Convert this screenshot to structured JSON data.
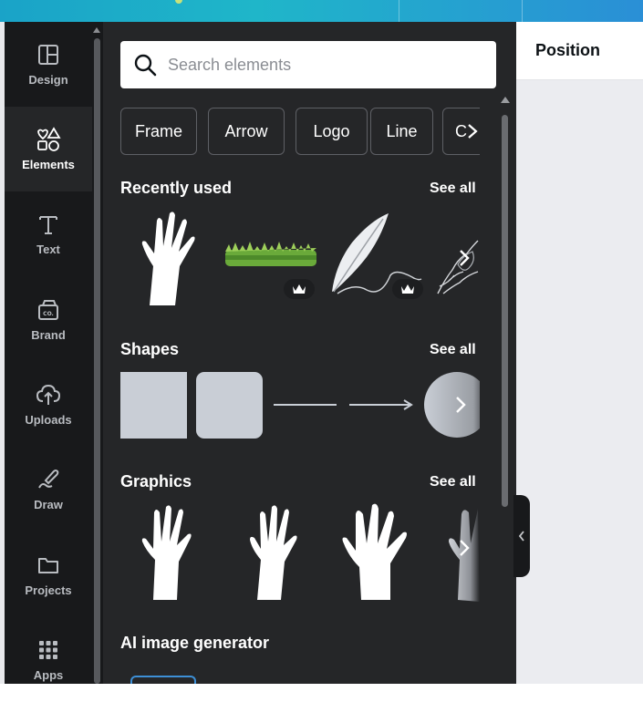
{
  "rail": {
    "items": [
      {
        "label": "Design",
        "icon": "layout-icon"
      },
      {
        "label": "Elements",
        "icon": "shapes-icon",
        "active": true
      },
      {
        "label": "Text",
        "icon": "text-icon"
      },
      {
        "label": "Brand",
        "icon": "brand-icon"
      },
      {
        "label": "Uploads",
        "icon": "cloud-upload-icon"
      },
      {
        "label": "Draw",
        "icon": "draw-icon"
      },
      {
        "label": "Projects",
        "icon": "folder-icon"
      },
      {
        "label": "Apps",
        "icon": "apps-grid-icon"
      }
    ]
  },
  "search": {
    "placeholder": "Search elements",
    "value": ""
  },
  "chips": [
    "Frame",
    "Arrow",
    "Logo",
    "Line",
    "C"
  ],
  "sections": {
    "recent": {
      "title": "Recently used",
      "see_all": "See all"
    },
    "shapes": {
      "title": "Shapes",
      "see_all": "See all"
    },
    "graphics": {
      "title": "Graphics",
      "see_all": "See all"
    },
    "ai": {
      "title": "AI image generator"
    }
  },
  "right_panel": {
    "title": "Position"
  },
  "colors": {
    "rail_bg": "#18191b",
    "panel_bg": "#252628",
    "shape_fill": "#c9ced6",
    "accent": "#3d8fd6"
  }
}
